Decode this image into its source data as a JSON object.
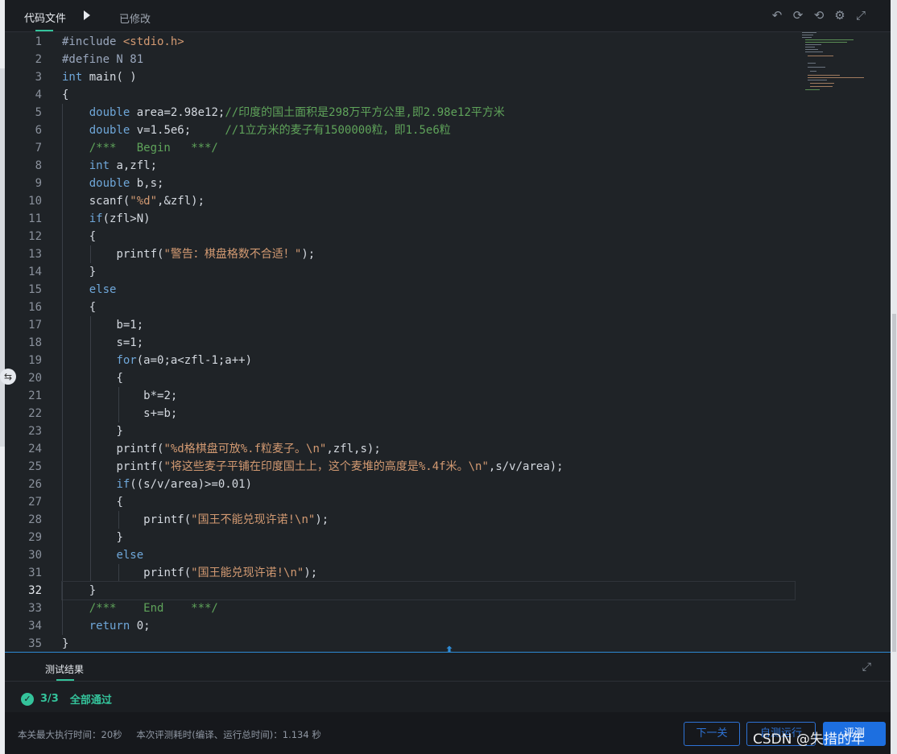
{
  "header": {
    "file_tab": "代码文件",
    "modified": "已修改",
    "icons": [
      "undo-icon",
      "refresh-icon",
      "history-icon",
      "gear-icon",
      "fullscreen-icon"
    ]
  },
  "editor": {
    "active_line": 32,
    "lines": [
      "1",
      "2",
      "3",
      "4",
      "5",
      "6",
      "7",
      "8",
      "9",
      "10",
      "11",
      "12",
      "13",
      "14",
      "15",
      "16",
      "17",
      "18",
      "19",
      "20",
      "21",
      "22",
      "23",
      "24",
      "25",
      "26",
      "27",
      "28",
      "29",
      "30",
      "31",
      "32",
      "33",
      "34",
      "35"
    ],
    "code": {
      "l1a": "#include ",
      "l1b": "<stdio.h>",
      "l2": "#define N 81",
      "l3a": "int",
      "l3b": " main( )",
      "l4": "{",
      "l5a": "double",
      "l5b": " area=2.98e12;",
      "l5c": "//印度的国土面积是298万平方公里,即2.98e12平方米",
      "l6a": "double",
      "l6b": " v=1.5e6;     ",
      "l6c": "//1立方米的麦子有1500000粒，即1.5e6粒",
      "l7": "/***   Begin   ***/",
      "l8a": "int",
      "l8b": " a,zfl;",
      "l9a": "double",
      "l9b": " b,s;",
      "l10a": "scanf(",
      "l10b": "\"%d\"",
      "l10c": ",&zfl);",
      "l11a": "if",
      "l11b": "(zfl>N)",
      "l12": "{",
      "l13a": "printf(",
      "l13b": "\"警告：棋盘格数不合适！\"",
      "l13c": ");",
      "l14": "}",
      "l15": "else",
      "l16": "{",
      "l17": "b=1;",
      "l18": "s=1;",
      "l19a": "for",
      "l19b": "(a=0;a<zfl-1;a++)",
      "l20": "{",
      "l21": "b*=2;",
      "l22": "s+=b;",
      "l23": "}",
      "l24a": "printf(",
      "l24b": "\"%d格棋盘可放%.f粒麦子。\\n\"",
      "l24c": ",zfl,s);",
      "l25a": "printf(",
      "l25b": "\"将这些麦子平铺在印度国土上，这个麦堆的高度是%.4f米。\\n\"",
      "l25c": ",s/v/area);",
      "l26a": "if",
      "l26b": "((s/v/area)>=0.01)",
      "l27": "{",
      "l28a": "printf(",
      "l28b": "\"国王不能兑现许诺!\\n\"",
      "l28c": ");",
      "l29": "}",
      "l30": "else",
      "l31a": "printf(",
      "l31b": "\"国王能兑现许诺!\\n\"",
      "l31c": ");",
      "l32": "}",
      "l33": "/***    End    ***/",
      "l34a": "return",
      "l34b": " 0;",
      "l35": "}"
    }
  },
  "results": {
    "title": "测试结果",
    "score": "3/3",
    "status": "全部通过"
  },
  "footer": {
    "max_time": "本关最大执行时间：20秒",
    "eval_time": "本次评测耗时(编译、运行总时间)：1.134 秒",
    "next_label": "下一关",
    "run_label": "自测运行",
    "eval_label": "评测",
    "watermark": "CSDN @失措的年"
  },
  "colors": {
    "accent_green": "#34c39b",
    "accent_blue": "#1d6fe0",
    "keyword": "#6fa7d9",
    "string": "#d39a72",
    "comment": "#5fa35a"
  }
}
